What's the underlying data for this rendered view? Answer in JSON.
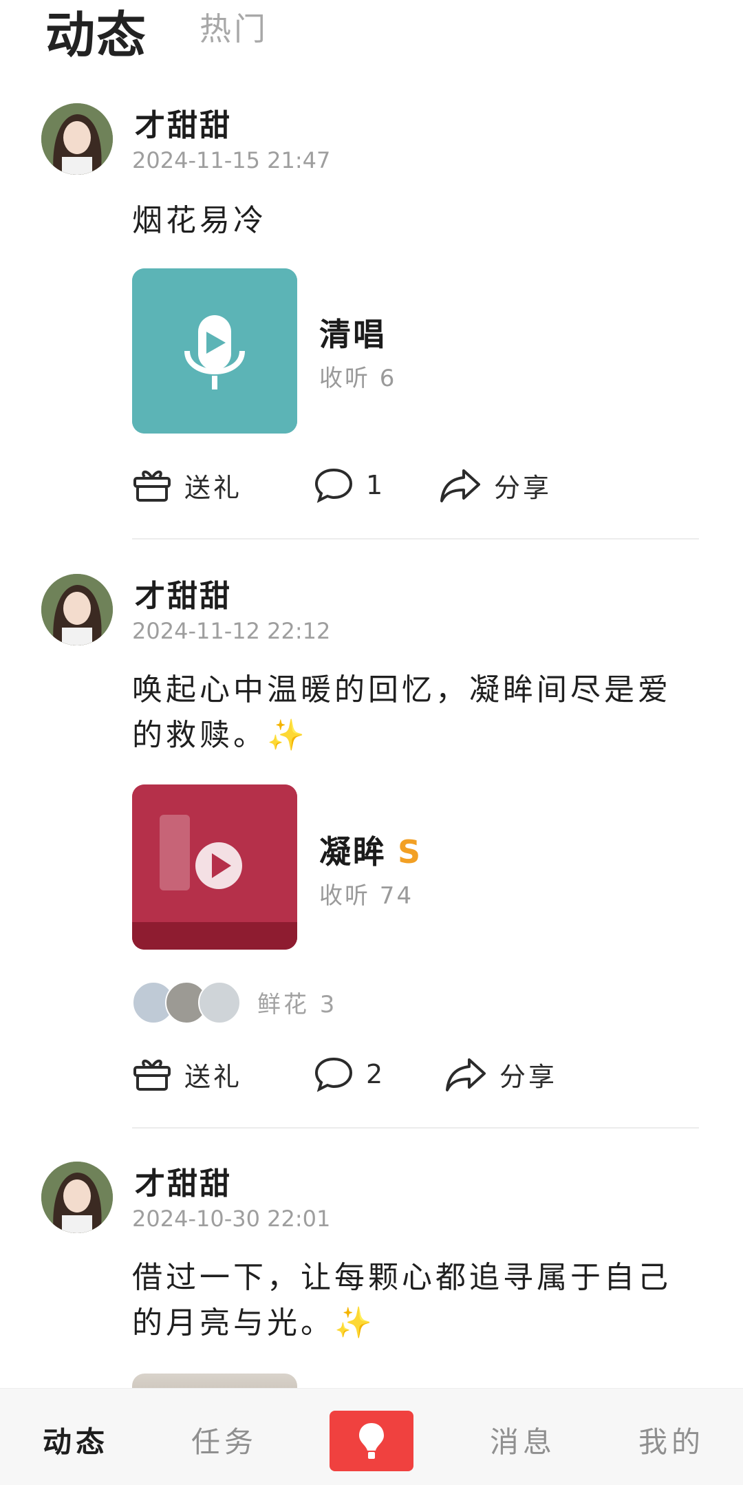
{
  "header": {
    "tabs": [
      {
        "label": "动态",
        "active": true
      },
      {
        "label": "热门",
        "active": false
      }
    ]
  },
  "posts": [
    {
      "author": "才甜甜",
      "time": "2024-11-15 21:47",
      "text": "烟花易冷",
      "song": {
        "title": "清唱",
        "listens": "收听 6",
        "badge": ""
      },
      "actions": {
        "gift": "送礼",
        "comments": "1",
        "share": "分享"
      }
    },
    {
      "author": "才甜甜",
      "time": "2024-11-12 22:12",
      "text": "唤起心中温暖的回忆，凝眸间尽是爱的救赎。✨",
      "song": {
        "title": "凝眸",
        "listens": "收听 74",
        "badge": "S"
      },
      "flowers": "鲜花 3",
      "actions": {
        "gift": "送礼",
        "comments": "2",
        "share": "分享"
      }
    },
    {
      "author": "才甜甜",
      "time": "2024-10-30 22:01",
      "text": "借过一下，让每颗心都追寻属于自己的月亮与光。✨"
    }
  ],
  "bottom_nav": {
    "items": [
      {
        "label": "动态",
        "active": true
      },
      {
        "label": "任务"
      },
      {
        "label": "消息"
      },
      {
        "label": "我的"
      }
    ]
  },
  "colors": {
    "accent": "#f0413f",
    "badge": "#f2a024",
    "teal": "#5cb4b6",
    "red_cover": "#b5304a"
  }
}
